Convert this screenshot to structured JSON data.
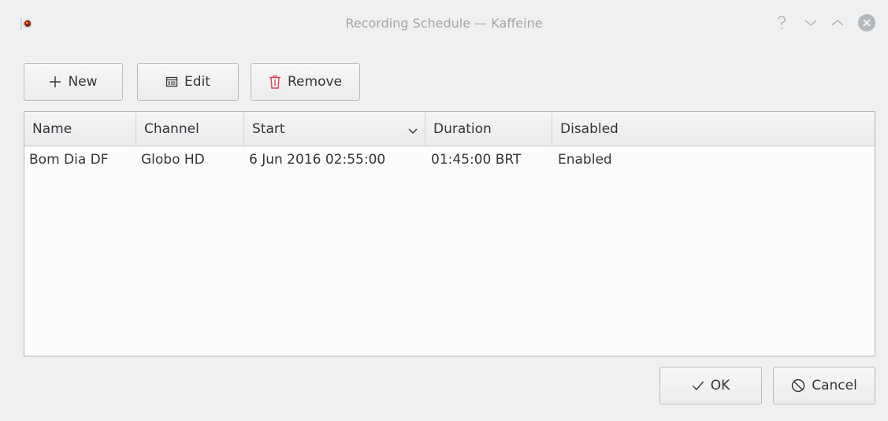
{
  "window": {
    "title": "Recording Schedule — Kaffeine"
  },
  "toolbar": {
    "new_label": "New",
    "edit_label": "Edit",
    "remove_label": "Remove"
  },
  "table": {
    "columns": [
      "Name",
      "Channel",
      "Start",
      "Duration",
      "Disabled"
    ],
    "rows": [
      {
        "name": "Bom Dia DF",
        "channel": "Globo HD",
        "start": "6 Jun 2016 02:55:00",
        "duration": "01:45:00 BRT",
        "disabled": "Enabled"
      }
    ]
  },
  "dialog": {
    "ok_label": "OK",
    "cancel_label": "Cancel"
  },
  "icons": {
    "app": "kaffeine-app-icon",
    "help": "help-icon",
    "minimize": "minimize-icon",
    "maximize": "maximize-icon",
    "close": "close-icon",
    "new": "plus-icon",
    "edit": "edit-icon",
    "remove": "trash-icon",
    "sort": "chevron-down-icon",
    "ok": "check-icon",
    "cancel": "cancel-icon"
  },
  "colors": {
    "background": "#eff0f1",
    "remove_icon": "#da4453",
    "title_text": "#a3a6a9"
  }
}
